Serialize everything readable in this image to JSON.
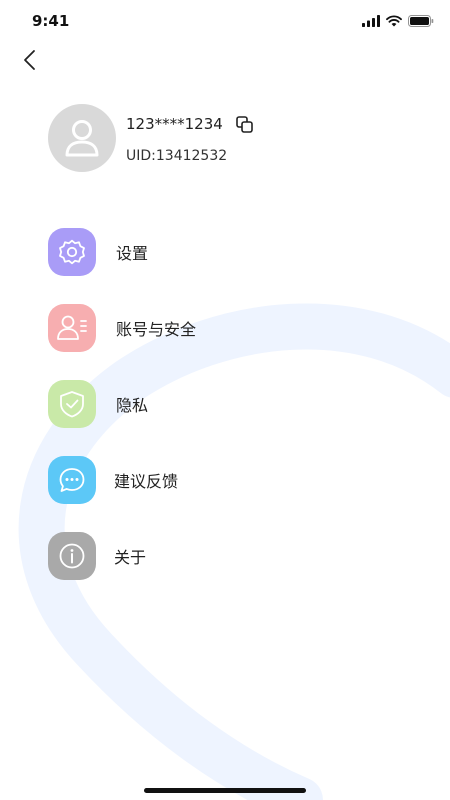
{
  "status_bar": {
    "time": "9:41",
    "icons": [
      "signal-icon",
      "wifi-icon",
      "battery-icon"
    ]
  },
  "nav": {
    "back_icon": "chevron-left-icon"
  },
  "profile": {
    "phone": "123****1234",
    "uid": "UID:13412532",
    "avatar_icon": "user-icon",
    "copy_icon": "copy-icon"
  },
  "menu": {
    "items": [
      {
        "label": "设置",
        "icon": "gear-icon",
        "color": "#a99cf7"
      },
      {
        "label": "账号与安全",
        "icon": "user-id-icon",
        "color": "#f7aeb0"
      },
      {
        "label": "隐私",
        "icon": "shield-check-icon",
        "color": "#c9e9a8"
      },
      {
        "label": "建议反馈",
        "icon": "chat-bubble-icon",
        "color": "#5cc8f7"
      },
      {
        "label": "关于",
        "icon": "info-icon",
        "color": "#a9a9a9"
      }
    ]
  },
  "colors": {
    "background": "#ffffff",
    "arc": "#eef4ff",
    "avatar_bg": "#d9d9d9"
  }
}
